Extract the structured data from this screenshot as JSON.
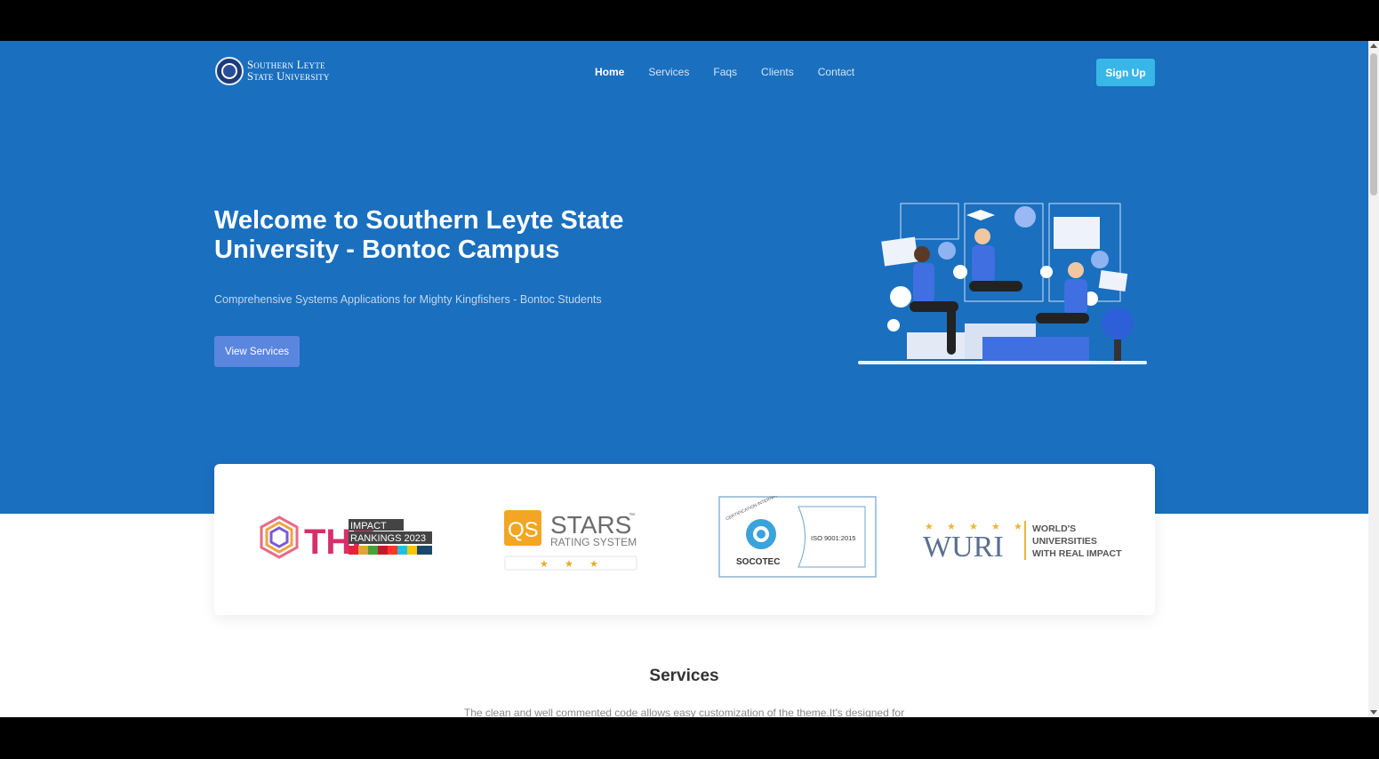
{
  "brand": {
    "line1": "Southern Leyte",
    "line2": "State University"
  },
  "nav": {
    "items": [
      {
        "label": "Home",
        "active": true
      },
      {
        "label": "Services",
        "active": false
      },
      {
        "label": "Faqs",
        "active": false
      },
      {
        "label": "Clients",
        "active": false
      },
      {
        "label": "Contact",
        "active": false
      }
    ]
  },
  "header": {
    "signup_label": "Sign Up"
  },
  "hero": {
    "title": "Welcome to Southern Leyte State University - Bontoc Campus",
    "subtitle": "Comprehensive Systems Applications for Mighty Kingfishers - Bontoc Students",
    "button_label": "View Services"
  },
  "partners": {
    "the": {
      "letters": "THE",
      "line1": "IMPACT",
      "line2": "RANKINGS 2023"
    },
    "qs": {
      "badge": "QS",
      "name": "STARS",
      "tm": "™",
      "sub": "RATING SYSTEM"
    },
    "socotec": {
      "ring": "CERTIFICATION INTERNATIONAL",
      "name": "SOCOTEC",
      "iso": "ISO 9001:2015"
    },
    "wuri": {
      "name": "WURI",
      "line1": "WORLD'S",
      "line2": "UNIVERSITIES",
      "line3": "WITH REAL IMPACT"
    }
  },
  "services": {
    "title": "Services",
    "description": "The clean and well commented code allows easy customization of the theme.It's designed for"
  },
  "colors": {
    "hero_bg": "#1a6fbf",
    "signup_bg": "#38b6e8",
    "view_btn_bg": "#5a86e0"
  }
}
